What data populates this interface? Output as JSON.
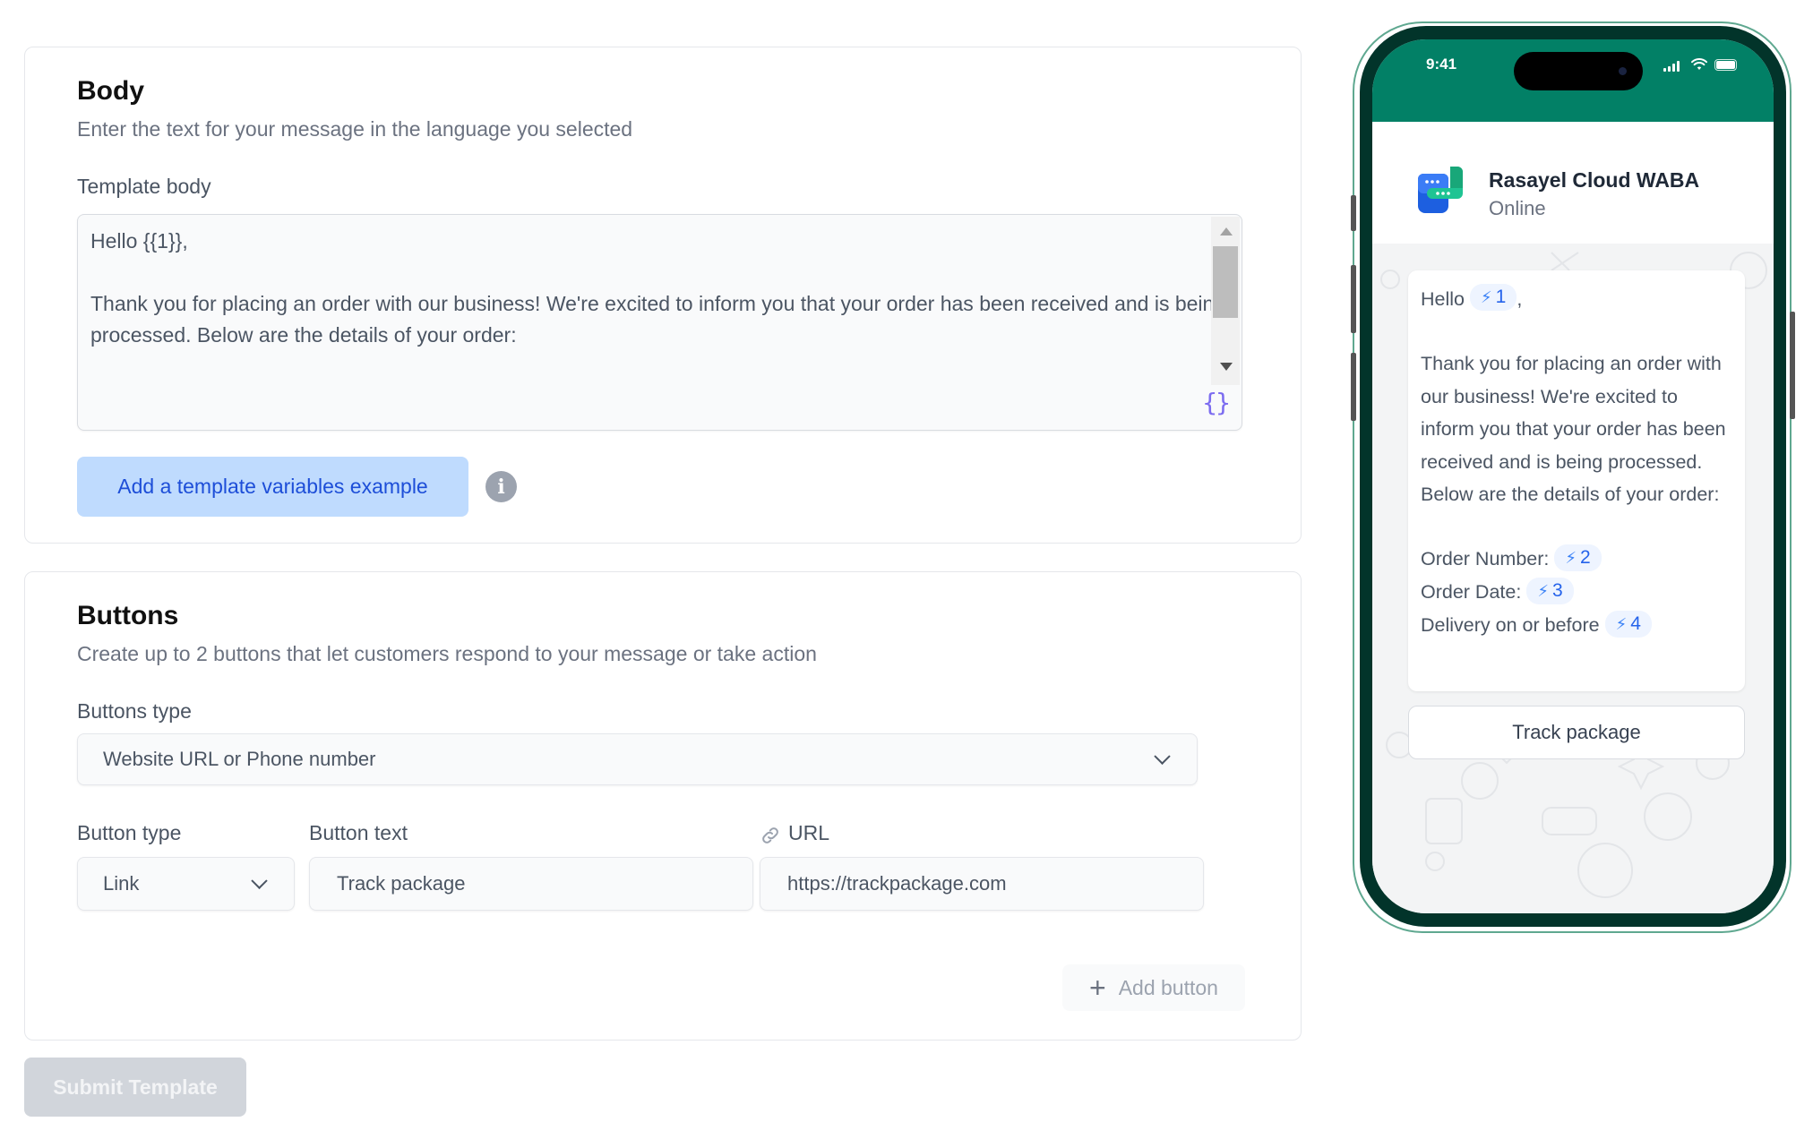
{
  "body_section": {
    "title": "Body",
    "subtitle": "Enter the text for your message in the language you selected",
    "template_body_label": "Template body",
    "template_body_value": "Hello {{1}},\n\nThank you for placing an order with our business! We're excited to inform you that your order has been received and is being processed. Below are the details of your order:",
    "variable_icon": "curly-braces-icon",
    "add_example_button": "Add a template variables example",
    "info_icon": "i"
  },
  "buttons_section": {
    "title": "Buttons",
    "subtitle": "Create up to 2 buttons that let customers respond to your message or take action",
    "buttons_type_label": "Buttons type",
    "buttons_type_value": "Website URL or Phone number",
    "button_type_label": "Button type",
    "button_type_value": "Link",
    "button_text_label": "Button text",
    "button_text_value": "Track package",
    "url_label": "URL",
    "url_value": "https://trackpackage.com",
    "add_button_label": "Add button"
  },
  "submit_button": "Submit Template",
  "phone_preview": {
    "time": "9:41",
    "contact_name": "Rasayel Cloud WABA",
    "contact_status": "Online",
    "message": {
      "greeting": "Hello",
      "greeting_var": "1",
      "greeting_suffix": ",",
      "paragraph": "Thank you for placing an order with our business! We're excited to inform you that your order has been received and is being processed. Below are the details of your order:",
      "lines": [
        {
          "label": "Order Number:",
          "var": "2"
        },
        {
          "label": "Order Date:",
          "var": "3"
        },
        {
          "label": "Delivery on or before",
          "var": "4"
        }
      ]
    },
    "cta_button": "Track package"
  },
  "colors": {
    "accent_blue": "#1d4ed8",
    "button_light_blue": "#bfdbfe",
    "whatsapp_green": "#028066",
    "phone_bezel": "#02342a",
    "variable_purple": "#7c6cf0"
  }
}
